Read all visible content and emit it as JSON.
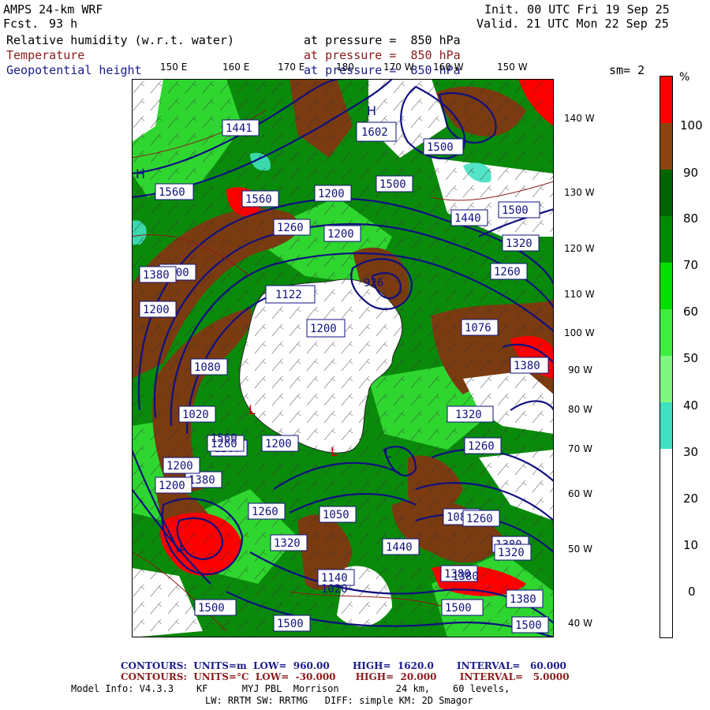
{
  "header": {
    "model": "AMPS 24-km WRF",
    "fcst_label": "Fcst.",
    "fcst_value": "93 h",
    "init": "Init. 00 UTC Fri 19 Sep 25",
    "valid": "Valid. 21 UTC Mon 22 Sep 25",
    "fields": [
      {
        "name": "Relative humidity (w.r.t. water)",
        "level": "at pressure =  850 hPa",
        "color": "#000000"
      },
      {
        "name": "Temperature",
        "level": "at pressure =  850 hPa",
        "color": "#8b1a1a"
      },
      {
        "name": "Geopotential height",
        "level": "at pressure =  850 hPa",
        "color": "#1a1a8b"
      }
    ],
    "smoothing": "sm= 2"
  },
  "map": {
    "top_lon_labels": [
      "150 E",
      "160 E",
      "170 E",
      "180",
      "170 W",
      "160 W",
      "150 W"
    ],
    "right_lat_labels": [
      "140 W",
      "130 W",
      "120 W",
      "110 W",
      "100 W",
      "90 W",
      "80 W",
      "70 W",
      "60 W",
      "50 W",
      "40 W"
    ],
    "height_labels": [
      "1441",
      "1602",
      "1500",
      "1560",
      "1500",
      "1560",
      "1200",
      "1260",
      "1200",
      "1500",
      "1440",
      "1500",
      "1320",
      "1380",
      "1260",
      "1122",
      "1200",
      "926",
      "1200",
      "1076",
      "1380",
      "1320",
      "1260",
      "1020",
      "1080",
      "1260",
      "1200",
      "1380",
      "1260",
      "1050",
      "1080",
      "1320",
      "1380",
      "1200",
      "1260",
      "1140",
      "1200",
      "1380",
      "1500",
      "1380",
      "1260",
      "1500",
      "1320",
      "1560",
      "1500",
      "1500",
      "1020",
      "1440",
      "1380"
    ],
    "markers": [
      "H",
      "H",
      "L",
      "L",
      "L",
      "L"
    ]
  },
  "colorbar": {
    "unit": "%",
    "labels": [
      "100",
      "90",
      "80",
      "70",
      "60",
      "50",
      "40",
      "30",
      "20",
      "10",
      "0"
    ],
    "colors": [
      "#ff0000",
      "#8b4513",
      "#006400",
      "#008c00",
      "#00d000",
      "#40e840",
      "#80f080",
      "#40e0c0",
      "#ffffff",
      "#ffffff",
      "#ffffff",
      "#ffffff"
    ]
  },
  "footer": {
    "line1": "CONTOURS:  UNITS=m  LOW=  960.00       HIGH=  1620.0       INTERVAL=   60.000",
    "line2": "CONTOURS:  UNITS=°C  LOW=  -30.000      HIGH=  20.000       INTERVAL=   5.0000",
    "line3": "Model Info: V4.3.3    KF      MYJ PBL  Morrison          24 km,    60 levels,",
    "line4": "LW: RRTM SW: RRTMG   DIFF: simple KM: 2D Smagor",
    "line1_color": "#1a1a8b",
    "line2_color": "#8b1a1a"
  }
}
